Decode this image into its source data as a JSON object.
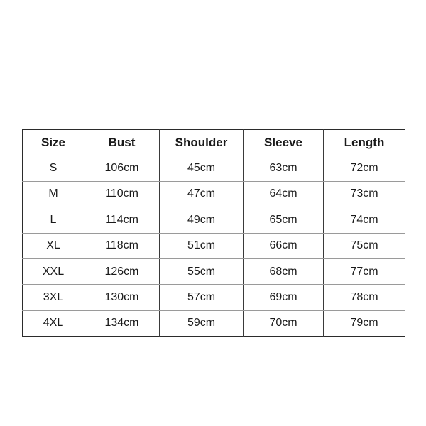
{
  "table": {
    "name": "size-chart",
    "columns": [
      "Size",
      "Bust",
      "Shoulder",
      "Sleeve",
      "Length"
    ],
    "rows": [
      {
        "size": "S",
        "bust": "106cm",
        "shoulder": "45cm",
        "sleeve": "63cm",
        "length": "72cm"
      },
      {
        "size": "M",
        "bust": "110cm",
        "shoulder": "47cm",
        "sleeve": "64cm",
        "length": "73cm"
      },
      {
        "size": "L",
        "bust": "114cm",
        "shoulder": "49cm",
        "sleeve": "65cm",
        "length": "74cm"
      },
      {
        "size": "XL",
        "bust": "118cm",
        "shoulder": "51cm",
        "sleeve": "66cm",
        "length": "75cm"
      },
      {
        "size": "XXL",
        "bust": "126cm",
        "shoulder": "55cm",
        "sleeve": "68cm",
        "length": "77cm"
      },
      {
        "size": "3XL",
        "bust": "130cm",
        "shoulder": "57cm",
        "sleeve": "69cm",
        "length": "78cm"
      },
      {
        "size": "4XL",
        "bust": "134cm",
        "shoulder": "59cm",
        "sleeve": "70cm",
        "length": "79cm"
      }
    ]
  },
  "colors": {
    "background": "#ffffff",
    "text": "#1a1a1a",
    "outer_border": "#2b2b2b",
    "vertical_rule": "#3a3a3a",
    "horizontal_rule": "#9a9a9a"
  }
}
